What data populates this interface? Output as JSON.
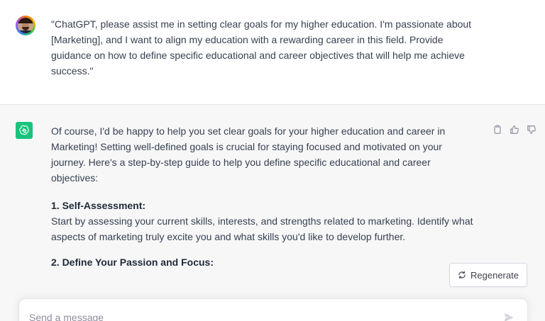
{
  "conversation": {
    "user_message": {
      "avatar_icon": "user-avatar",
      "text": "\"ChatGPT, please assist me in setting clear goals for my higher education. I'm passionate about [Marketing], and I want to align my education with a rewarding career in this field. Provide guidance on how to define specific educational and career objectives that will help me achieve success.\""
    },
    "assistant_message": {
      "logo_icon": "chatgpt-logo-icon",
      "intro": "Of course, I'd be happy to help you set clear goals for your higher education and career in Marketing! Setting well-defined goals is crucial for staying focused and motivated on your journey. Here's a step-by-step guide to help you define specific educational and career objectives:",
      "step1_heading": "1. Self-Assessment:",
      "step1_text": "Start by assessing your current skills, interests, and strengths related to marketing. Identify what aspects of marketing truly excite you and what skills you'd like to develop further.",
      "step2_heading": "2. Define Your Passion and Focus:",
      "actions": [
        "copy-icon",
        "thumbs-up-icon",
        "thumbs-down-icon"
      ]
    }
  },
  "controls": {
    "regenerate_label": "Regenerate",
    "regenerate_icon": "refresh-icon"
  },
  "composer": {
    "placeholder": "Send a message",
    "value": "",
    "send_icon": "send-icon"
  },
  "colors": {
    "brand_green": "#19c37d",
    "assistant_bg": "#f7f7f8",
    "text": "#374151"
  }
}
